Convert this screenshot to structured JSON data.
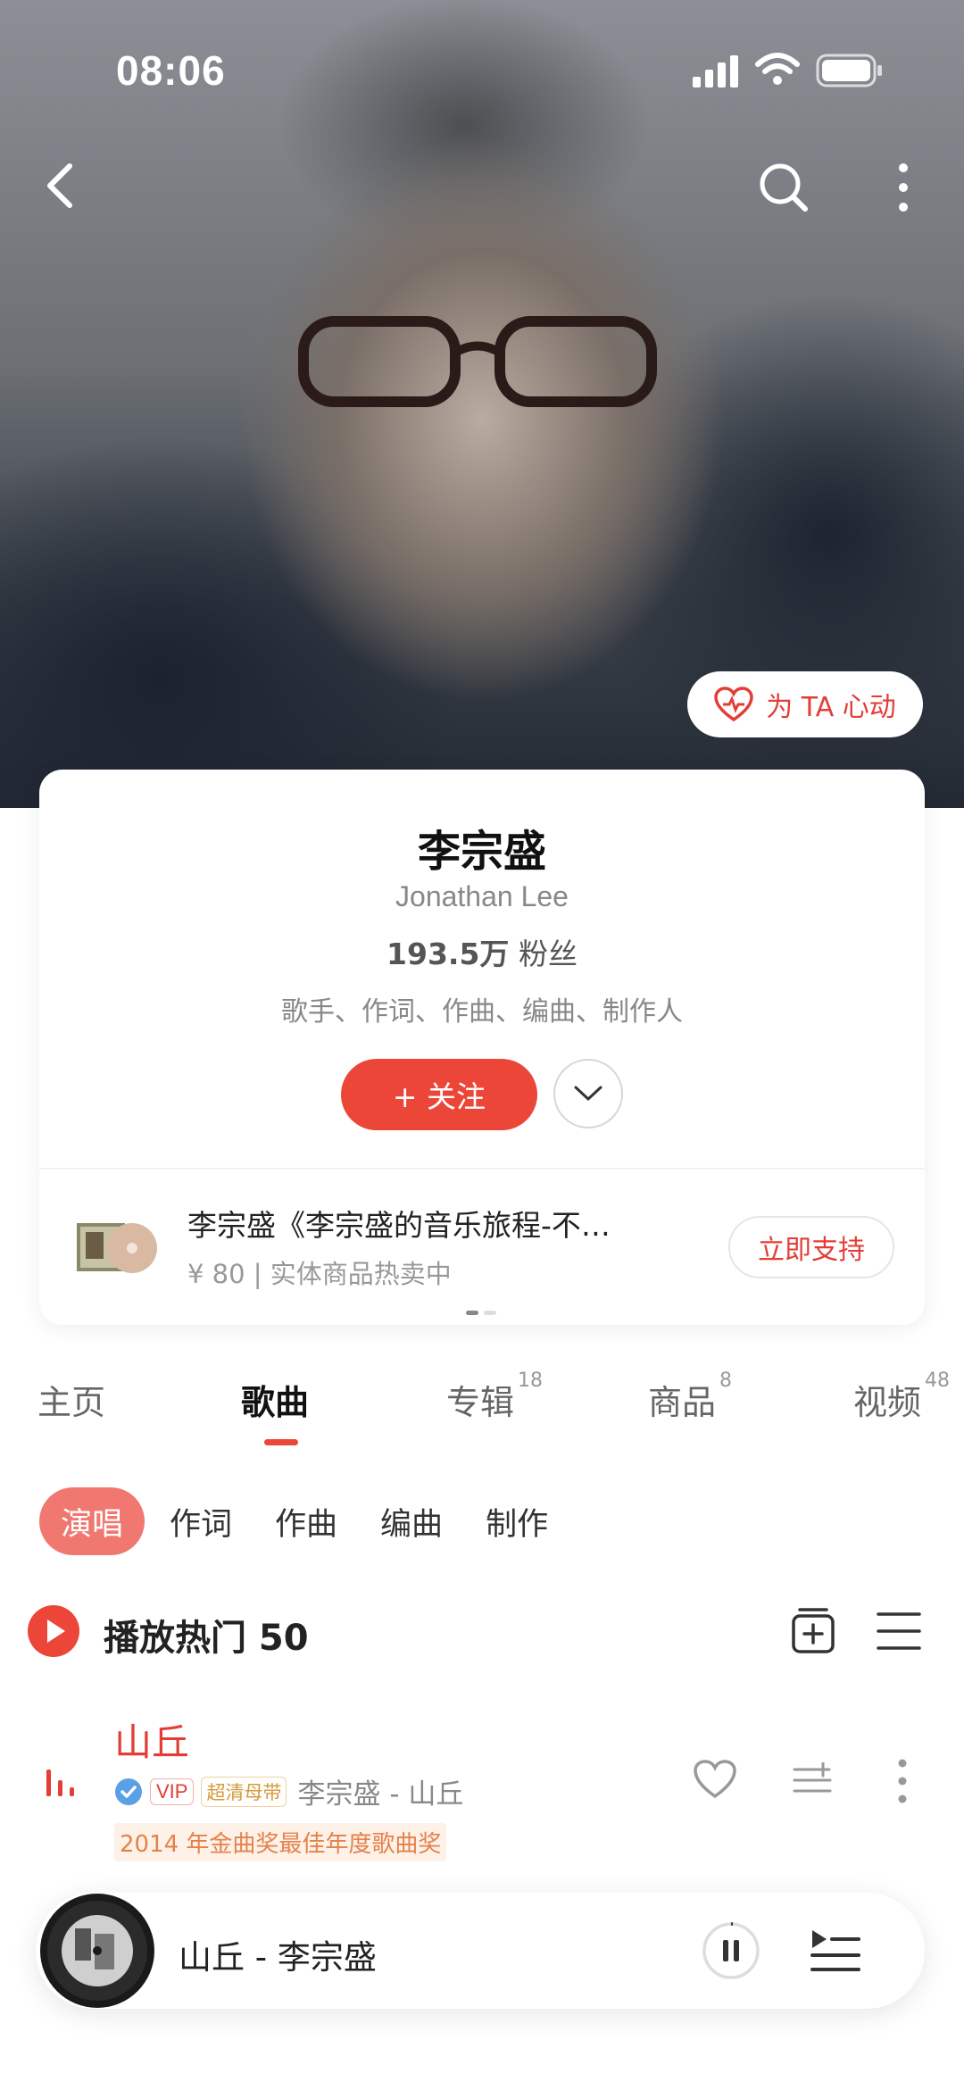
{
  "status_bar": {
    "time": "08:06"
  },
  "hero": {
    "heart_button_label": "为 TA 心动"
  },
  "profile": {
    "name": "李宗盛",
    "name_en": "Jonathan Lee",
    "fans_count": "193.5万",
    "fans_label": "粉丝",
    "roles": "歌手、作词、作曲、编曲、制作人",
    "follow_label": "+ 关注"
  },
  "promo": {
    "title": "李宗盛《李宗盛的音乐旅程-不…",
    "subtitle": "¥ 80 | 实体商品热卖中",
    "button_label": "立即支持"
  },
  "tabs": [
    {
      "label": "主页",
      "count": ""
    },
    {
      "label": "歌曲",
      "count": ""
    },
    {
      "label": "专辑",
      "count": "18"
    },
    {
      "label": "商品",
      "count": "8"
    },
    {
      "label": "视频",
      "count": "48"
    }
  ],
  "active_tab": "歌曲",
  "subtabs": [
    "演唱",
    "作词",
    "作曲",
    "编曲",
    "制作"
  ],
  "play_all": {
    "label": "播放热门 50"
  },
  "songs": [
    {
      "title": "山丘",
      "vip_badge": "VIP",
      "quality_badge": "超清母带",
      "artist_album": "李宗盛 - 山丘",
      "award": "2014 年金曲奖最佳年度歌曲奖",
      "playing": true
    }
  ],
  "player": {
    "now_playing": "山丘 - 李宗盛"
  },
  "colors": {
    "accent": "#eb4638",
    "accent_light": "#f07871",
    "award_text": "#e5824b"
  },
  "icons": [
    "back-icon",
    "search-icon",
    "more-vertical-icon",
    "heart-icon",
    "chevron-down-icon",
    "play-icon",
    "add-playlist-icon",
    "list-menu-icon",
    "equalizer-icon",
    "verified-icon",
    "like-icon",
    "add-to-queue-icon",
    "pause-icon",
    "queue-icon"
  ]
}
